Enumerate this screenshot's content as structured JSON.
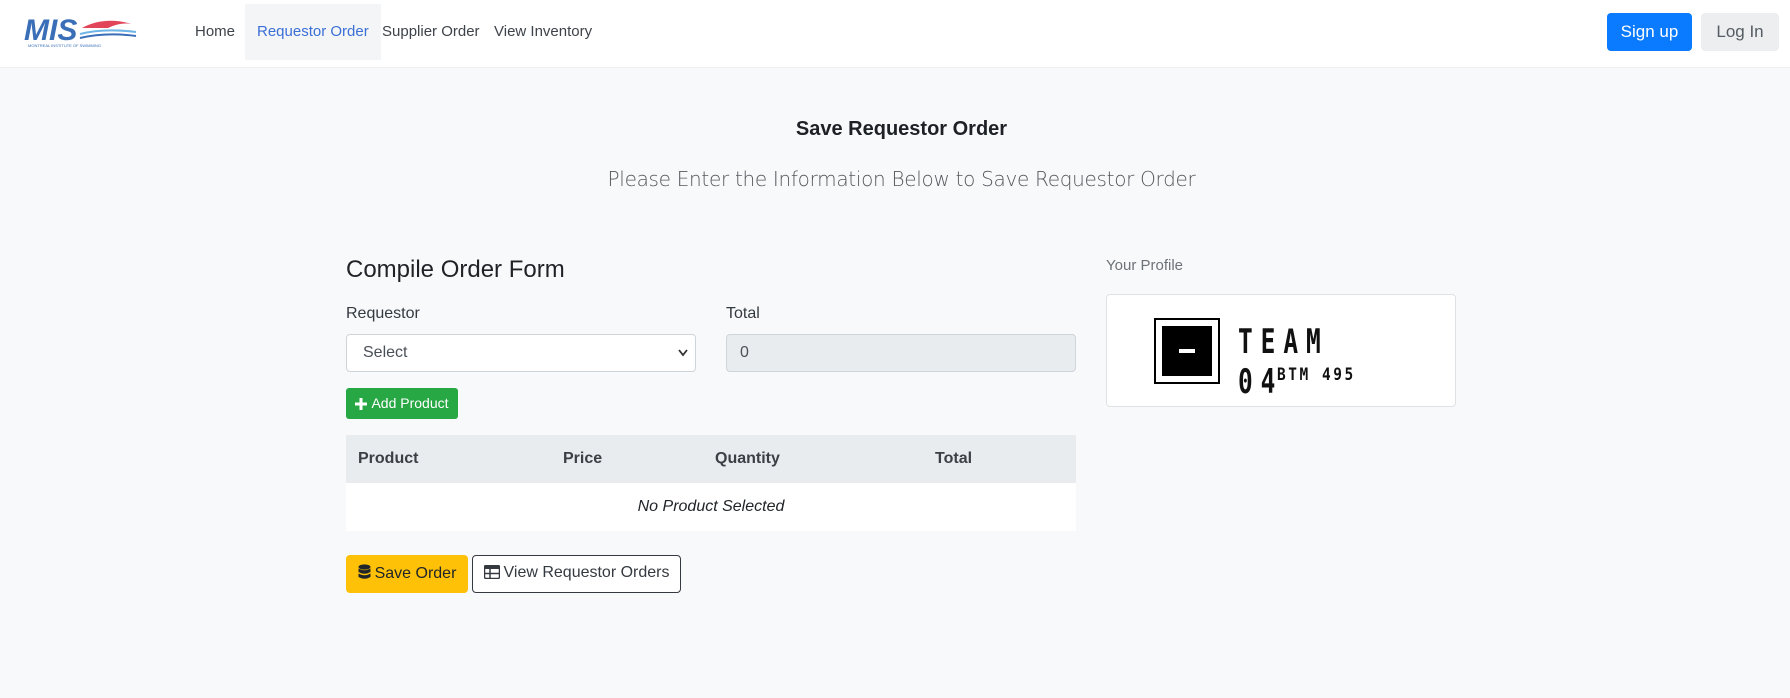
{
  "brand": {
    "logo_text": "MIS",
    "logo_subtext": "MONTREAL INSTITUTE OF SWIMMING"
  },
  "nav": {
    "items": [
      {
        "label": "Home",
        "active": false
      },
      {
        "label": "Requestor Order",
        "active": true
      },
      {
        "label": "Supplier Order",
        "active": false
      },
      {
        "label": "View Inventory",
        "active": false
      }
    ],
    "signup_label": "Sign up",
    "login_label": "Log In"
  },
  "header": {
    "title": "Save Requestor Order",
    "subtitle": "Please Enter the Information Below to Save Requestor Order"
  },
  "form": {
    "title": "Compile Order Form",
    "requestor_label": "Requestor",
    "requestor_value": "Select",
    "total_label": "Total",
    "total_value": "0",
    "add_product_label": "Add Product"
  },
  "table": {
    "columns": [
      "Product",
      "Price",
      "Quantity",
      "Total"
    ],
    "empty_message": "No Product Selected"
  },
  "actions": {
    "save_label": "Save Order",
    "view_label": "View Requestor Orders"
  },
  "profile": {
    "title": "Your Profile",
    "team_name": "TEAM 04",
    "team_subtitle": "BTM 495"
  },
  "colors": {
    "primary": "#0a7bff",
    "success": "#28a745",
    "warning": "#ffc107",
    "nav_active": "#3b6fd6"
  }
}
